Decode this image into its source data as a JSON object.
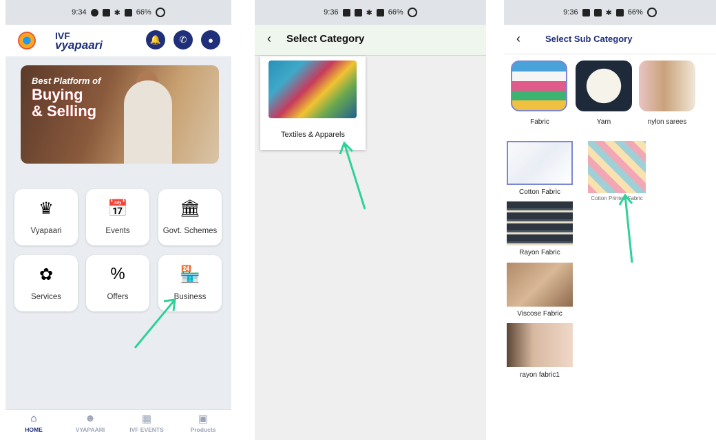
{
  "phone1": {
    "status_time": "9:34",
    "battery": "66%",
    "logo_line1": "IVF",
    "logo_line2": "vyapaari",
    "banner_line1": "Best Platform of",
    "banner_line2": "Buying",
    "banner_line3": "& Selling",
    "tiles": [
      {
        "label": "Vyapaari",
        "icon": "crown-icon"
      },
      {
        "label": "Events",
        "icon": "calendar-icon"
      },
      {
        "label": "Govt. Schemes",
        "icon": "government-building-icon"
      },
      {
        "label": "Services",
        "icon": "services-stack-icon"
      },
      {
        "label": "Offers",
        "icon": "percent-flame-icon"
      },
      {
        "label": "Business",
        "icon": "store-search-icon"
      }
    ],
    "nav": [
      {
        "label": "HOME",
        "icon": "home-icon"
      },
      {
        "label": "VYAPAARI",
        "icon": "users-icon"
      },
      {
        "label": "IVF EVENTS",
        "icon": "calendar-icon"
      },
      {
        "label": "Products",
        "icon": "products-icon"
      }
    ]
  },
  "phone2": {
    "status_time": "9:36",
    "battery": "66%",
    "title": "Select Category",
    "category": {
      "label": "Textiles & Apparels"
    }
  },
  "phone3": {
    "status_time": "9:36",
    "battery": "66%",
    "title": "Select Sub Category",
    "top_categories": [
      "Fabric",
      "Yarn",
      "nylon sarees"
    ],
    "sub_items": [
      "Cotton Fabric",
      "Cotton Printed Fabric",
      "Rayon Fabric",
      "Viscose Fabric",
      "rayon fabric1"
    ]
  },
  "colors": {
    "brand": "#1f2f7a",
    "arrow": "#2ed197"
  }
}
